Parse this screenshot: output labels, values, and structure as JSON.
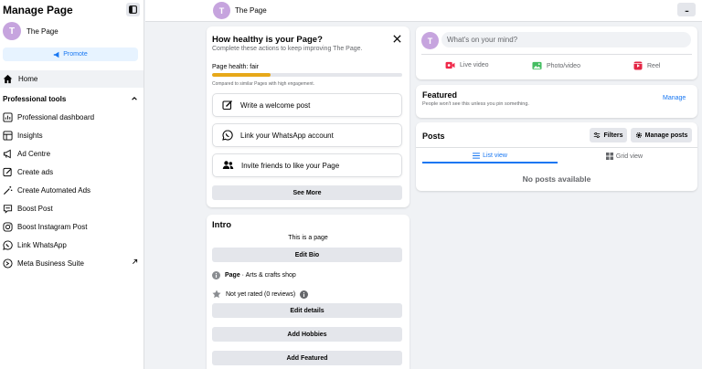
{
  "sidebar": {
    "title": "Manage Page",
    "page_name": "The Page",
    "avatar_letter": "T",
    "promote_label": "Promote",
    "home_label": "Home",
    "section_title": "Professional tools",
    "items": [
      {
        "label": "Professional dashboard",
        "icon": "dashboard-icon"
      },
      {
        "label": "Insights",
        "icon": "insights-icon"
      },
      {
        "label": "Ad Centre",
        "icon": "megaphone-icon"
      },
      {
        "label": "Create ads",
        "icon": "pencil-icon"
      },
      {
        "label": "Create Automated Ads",
        "icon": "magic-wand-icon"
      },
      {
        "label": "Boost Post",
        "icon": "boost-post-icon"
      },
      {
        "label": "Boost Instagram Post",
        "icon": "instagram-icon"
      },
      {
        "label": "Link WhatsApp",
        "icon": "whatsapp-icon"
      },
      {
        "label": "Meta Business Suite",
        "icon": "meta-business-icon"
      }
    ]
  },
  "topbar": {
    "page_name": "The Page",
    "avatar_letter": "T",
    "more_label": "..."
  },
  "health": {
    "title": "How healthy is your Page?",
    "subtitle": "Complete these actions to keep improving The Page.",
    "health_label": "Page health: fair",
    "progress": 0.31,
    "note": "Compared to similar Pages with high engagement.",
    "actions": [
      {
        "label": "Write a welcome post",
        "icon": "edit-icon"
      },
      {
        "label": "Link your WhatsApp account",
        "icon": "whatsapp-icon"
      },
      {
        "label": "Invite friends to like your Page",
        "icon": "people-icon"
      }
    ],
    "see_more_label": "See More"
  },
  "intro": {
    "title": "Intro",
    "description": "This is a page",
    "edit_bio_label": "Edit Bio",
    "page_type_bold": "Page",
    "page_type_rest": " · Arts & crafts shop",
    "rating": "Not yet rated (0 reviews)",
    "edit_details_label": "Edit details",
    "add_hobbies_label": "Add Hobbies",
    "add_featured_label": "Add Featured"
  },
  "composer": {
    "avatar_letter": "T",
    "placeholder": "What's on your mind?",
    "actions": [
      {
        "label": "Live video",
        "icon": "live-video-icon",
        "color": "#f02849"
      },
      {
        "label": "Photo/video",
        "icon": "photo-icon",
        "color": "#45bd62"
      },
      {
        "label": "Reel",
        "icon": "reel-icon",
        "color": "#e42645"
      }
    ]
  },
  "featured": {
    "title": "Featured",
    "subtitle": "People won't see this unless you pin something.",
    "manage_label": "Manage"
  },
  "posts": {
    "title": "Posts",
    "filters_label": "Filters",
    "manage_posts_label": "Manage posts",
    "tabs": [
      {
        "label": "List view",
        "icon": "list-icon",
        "active": true
      },
      {
        "label": "Grid view",
        "icon": "grid-icon",
        "active": false
      }
    ],
    "empty_text": "No posts available"
  },
  "colors": {
    "accent": "#1877f2",
    "health_bar": "#e7a819",
    "avatar": "#c6a4de"
  }
}
